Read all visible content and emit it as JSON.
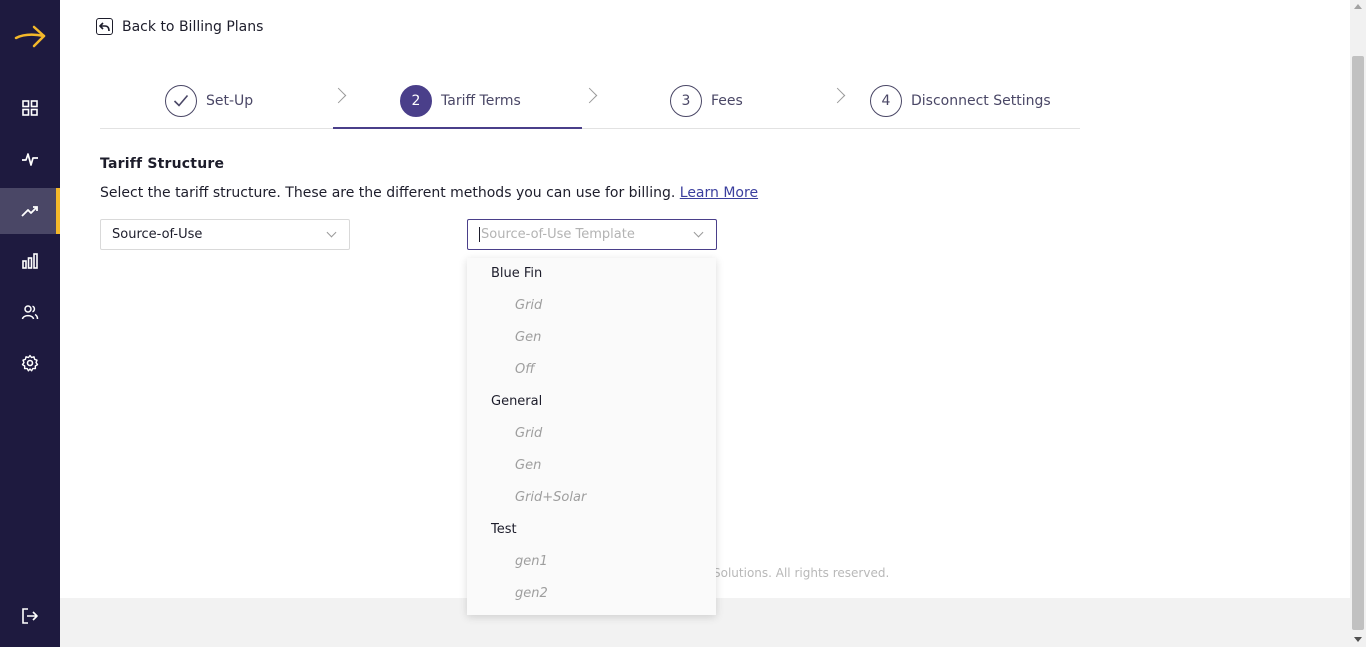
{
  "sidebar": {
    "logo_icon": "arrow-logo",
    "accent": "#f4b82a",
    "items": [
      {
        "name": "dashboard",
        "icon": "grid-icon"
      },
      {
        "name": "activity",
        "icon": "pulse-icon"
      },
      {
        "name": "billing",
        "icon": "trending-up-icon",
        "active": true
      },
      {
        "name": "reports",
        "icon": "bar-chart-icon"
      },
      {
        "name": "users",
        "icon": "users-icon"
      },
      {
        "name": "settings",
        "icon": "gear-icon"
      }
    ],
    "logout_icon": "logout-icon"
  },
  "header": {
    "back_label": "Back to Billing Plans"
  },
  "steps": [
    {
      "number": "✓",
      "label": "Set-Up",
      "state": "done"
    },
    {
      "number": "2",
      "label": "Tariff Terms",
      "state": "active"
    },
    {
      "number": "3",
      "label": "Fees",
      "state": "upcoming"
    },
    {
      "number": "4",
      "label": "Disconnect Settings",
      "state": "upcoming"
    }
  ],
  "tariff": {
    "title": "Tariff Structure",
    "description": "Select the tariff structure. These are the different methods you can use for billing.",
    "learn_more": "Learn More",
    "structure_value": "Source-of-Use",
    "template_placeholder": "Source-of-Use Template"
  },
  "dropdown": {
    "groups": [
      {
        "label": "Blue Fin",
        "items": [
          "Grid",
          "Gen",
          "Off"
        ]
      },
      {
        "label": "General",
        "items": [
          "Grid",
          "Gen",
          "Grid+Solar"
        ]
      },
      {
        "label": "Test",
        "items": [
          "gen1",
          "gen2"
        ]
      }
    ]
  },
  "footer": {
    "copyright": "Solutions. All rights reserved."
  }
}
